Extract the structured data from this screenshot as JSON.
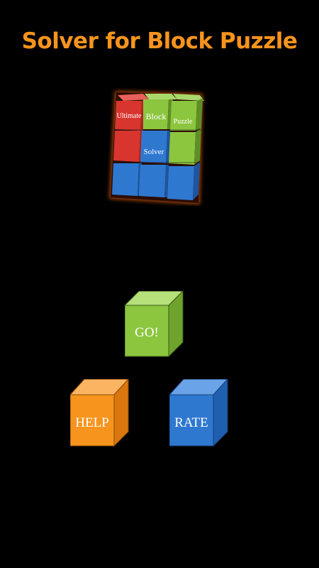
{
  "app": {
    "title": "Solver for Block Puzzle"
  },
  "logo": {
    "words": {
      "ultimate": "Ultimate",
      "block": "Block",
      "puzzle": "Puzzle",
      "solver": "Solver"
    }
  },
  "buttons": {
    "go": "GO!",
    "help": "HELP",
    "rate": "RATE"
  },
  "colors": {
    "background": "#000000",
    "title": "#f7941d",
    "red": "#d8352f",
    "green": "#8cc63f",
    "blue": "#2f78d0",
    "orange": "#f7941d",
    "glow": "#b2480f"
  }
}
